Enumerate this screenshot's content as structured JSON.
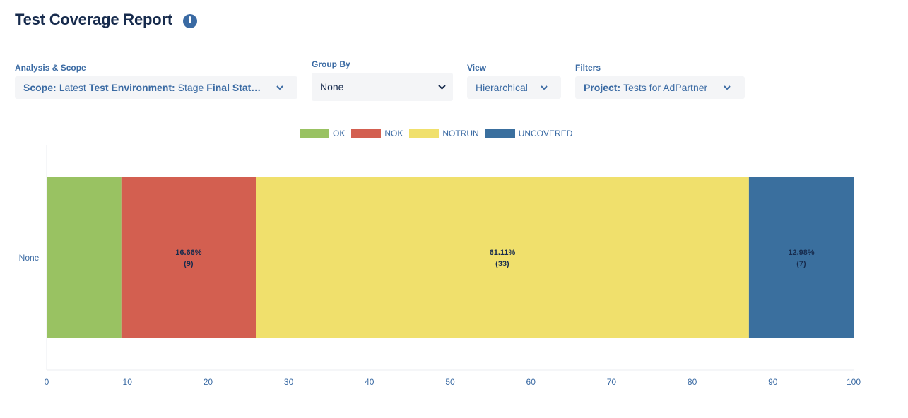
{
  "header": {
    "title": "Test Coverage Report",
    "info_icon": "info-icon"
  },
  "controls": {
    "analysis_scope": {
      "label": "Analysis & Scope",
      "scope_key": "Scope:",
      "scope_value": "Latest",
      "env_key": "Test Environment:",
      "env_value": "Stage",
      "final_key": "Final Stat…"
    },
    "group_by": {
      "label": "Group By",
      "value": "None"
    },
    "view": {
      "label": "View",
      "value": "Hierarchical"
    },
    "filters": {
      "label": "Filters",
      "project_key": "Project:",
      "project_value": "Tests for AdPartner"
    }
  },
  "legend": [
    {
      "label": "OK",
      "color": "#99c262"
    },
    {
      "label": "NOK",
      "color": "#d35f50"
    },
    {
      "label": "NOTRUN",
      "color": "#f0e06c"
    },
    {
      "label": "UNCOVERED",
      "color": "#3a6f9e"
    }
  ],
  "chart_data": {
    "type": "bar",
    "orientation": "horizontal",
    "stacked": true,
    "categories": [
      "None"
    ],
    "series": [
      {
        "name": "OK",
        "values": [
          9.26
        ],
        "color": "#99c262",
        "label": ""
      },
      {
        "name": "NOK",
        "values": [
          16.66
        ],
        "color": "#d35f50",
        "label": "16.66%",
        "count": "(9)"
      },
      {
        "name": "NOTRUN",
        "values": [
          61.11
        ],
        "color": "#f0e06c",
        "label": "61.11%",
        "count": "(33)"
      },
      {
        "name": "UNCOVERED",
        "values": [
          12.98
        ],
        "color": "#3a6f9e",
        "label": "12.98%",
        "count": "(7)"
      }
    ],
    "xlim": [
      0,
      100
    ],
    "xticks": [
      "0",
      "10",
      "20",
      "30",
      "40",
      "50",
      "60",
      "70",
      "80",
      "90",
      "100"
    ],
    "legend_position": "top",
    "grid": false
  }
}
